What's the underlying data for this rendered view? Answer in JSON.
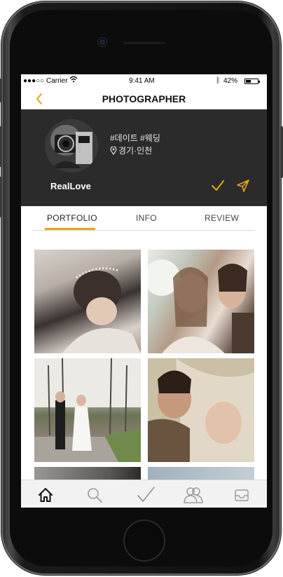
{
  "status_bar": {
    "carrier": "●●●○○ Carrier",
    "time": "9:41 AM",
    "battery_percent": "42%",
    "battery_level": 0.42
  },
  "nav": {
    "title": "PHOTOGRAPHER",
    "back_icon": "chevron-left-icon"
  },
  "profile": {
    "tags": "#데이트 #웨딩",
    "location": "경기·인천",
    "name": "RealLove"
  },
  "tabs": [
    {
      "label": "PORTFOLIO",
      "active": true
    },
    {
      "label": "INFO",
      "active": false
    },
    {
      "label": "REVIEW",
      "active": false
    }
  ],
  "colors": {
    "accent": "#e3a51d",
    "header_bg": "#2b2b2b",
    "tabbar_bg": "#f2f2f2"
  },
  "bottom_tabs": [
    {
      "icon": "home-icon"
    },
    {
      "icon": "search-icon"
    },
    {
      "icon": "check-icon"
    },
    {
      "icon": "people-icon"
    },
    {
      "icon": "inbox-icon"
    }
  ]
}
